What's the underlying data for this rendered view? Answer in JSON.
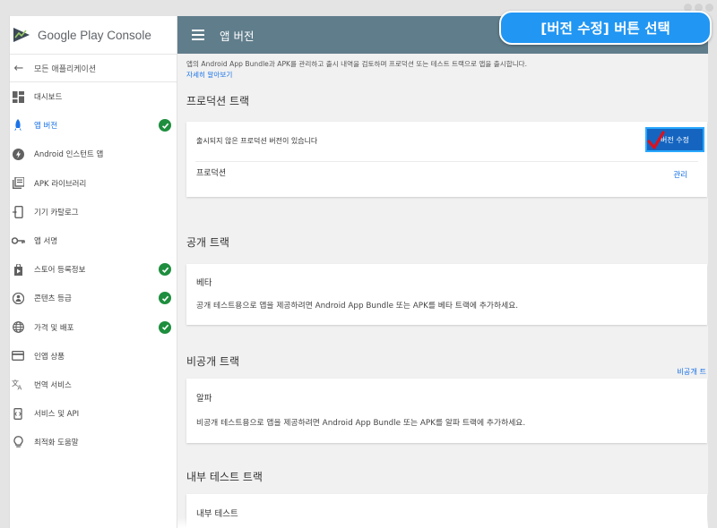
{
  "brand": {
    "name": "Google Play Console"
  },
  "sidebar": {
    "back_label": "모든 애플리케이션",
    "items": [
      {
        "label": "대시보드",
        "icon": "dashboard-icon",
        "checked": false
      },
      {
        "label": "앱 버전",
        "icon": "rocket-icon",
        "checked": true,
        "active": true
      },
      {
        "label": "Android 인스턴트 앱",
        "icon": "instant-bolt-icon",
        "checked": false
      },
      {
        "label": "APK 라이브러리",
        "icon": "library-icon",
        "checked": false
      },
      {
        "label": "기기 카탈로그",
        "icon": "device-catalog-icon",
        "checked": false
      },
      {
        "label": "앱 서명",
        "icon": "key-icon",
        "checked": false
      },
      {
        "label": "스토어 등록정보",
        "icon": "store-listing-icon",
        "checked": true
      },
      {
        "label": "콘텐츠 등급",
        "icon": "content-rating-icon",
        "checked": true
      },
      {
        "label": "가격 및 배포",
        "icon": "globe-icon",
        "checked": true
      },
      {
        "label": "인앱 상품",
        "icon": "credit-card-icon",
        "checked": false
      },
      {
        "label": "번역 서비스",
        "icon": "translate-icon",
        "checked": false
      },
      {
        "label": "서비스 및 API",
        "icon": "api-icon",
        "checked": false
      },
      {
        "label": "최적화 도움말",
        "icon": "lightbulb-icon",
        "checked": false
      }
    ]
  },
  "header": {
    "title": "앱 버전"
  },
  "callout": {
    "text": "[버전 수정] 버튼 선택"
  },
  "main": {
    "description": "앱의 Android App Bundle과 APK를 관리하고 출시 내역을 검토하며 프로덕션 또는 테스트 트랙으로 앱을 출시합니다.",
    "learn_more": "자세히 알아보기",
    "production": {
      "section_title": "프로덕션 트랙",
      "unreleased_notice": "출시되지 않은 프로덕션 버전이 있습니다",
      "edit_button": "버전 수정",
      "track_name": "프로덕션",
      "manage_link": "관리"
    },
    "open": {
      "section_title": "공개 트랙",
      "track_name": "베타",
      "text": "공개 테스트용으로 앱을 제공하려면 Android App Bundle 또는 APK를 베타 트랙에 추가하세요."
    },
    "closed": {
      "section_title": "비공개 트랙",
      "link": "비공개 트",
      "track_name": "알파",
      "text": "비공개 테스트용으로 앱을 제공하려면 Android App Bundle 또는 APK를 알파 트랙에 추가하세요."
    },
    "internal": {
      "section_title": "내부 테스트 트랙",
      "track_name": "내부 테스트"
    }
  },
  "colors": {
    "topbar": "#607d8b",
    "accent": "#1a73e8",
    "check": "#1e8e3e",
    "callout": "#2196f3",
    "button": "#1565c0"
  }
}
